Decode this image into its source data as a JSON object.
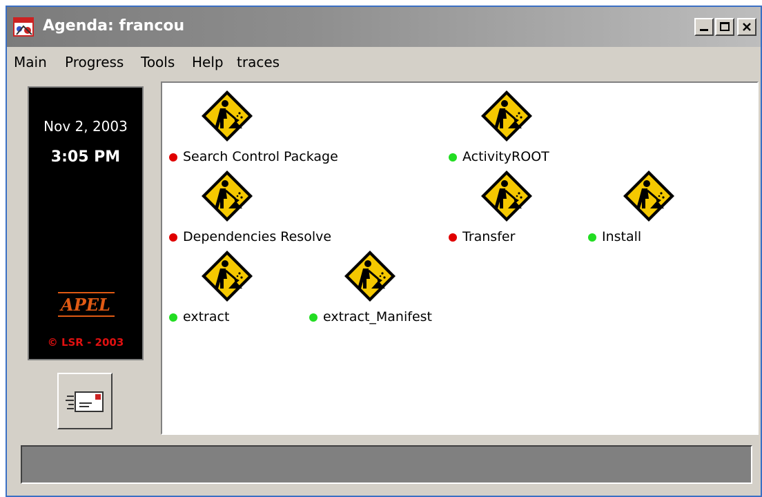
{
  "window": {
    "title": "Agenda: francou",
    "icon": "agenda-app-icon"
  },
  "menu": [
    {
      "label": "Main"
    },
    {
      "label": "Progress"
    },
    {
      "label": "Tools"
    },
    {
      "label": "Help"
    },
    {
      "label": "traces"
    }
  ],
  "clock": {
    "date": "Nov 2, 2003",
    "time": "3:05 PM",
    "brand": "APEL",
    "copyright": "LSR - 2003"
  },
  "colors": {
    "status_red": "#e00000",
    "status_green": "#22dd22",
    "sign_yellow": "#f5c800",
    "brand_orange": "#e05a14"
  },
  "activities": [
    {
      "name": "Search Control Package",
      "status": "red"
    },
    {
      "name": "ActivityROOT",
      "status": "green"
    },
    {
      "name": "Dependencies Resolve",
      "status": "red"
    },
    {
      "name": "Transfer",
      "status": "red"
    },
    {
      "name": "Install",
      "status": "green"
    },
    {
      "name": "extract",
      "status": "green"
    },
    {
      "name": "extract_Manifest",
      "status": "green"
    }
  ]
}
